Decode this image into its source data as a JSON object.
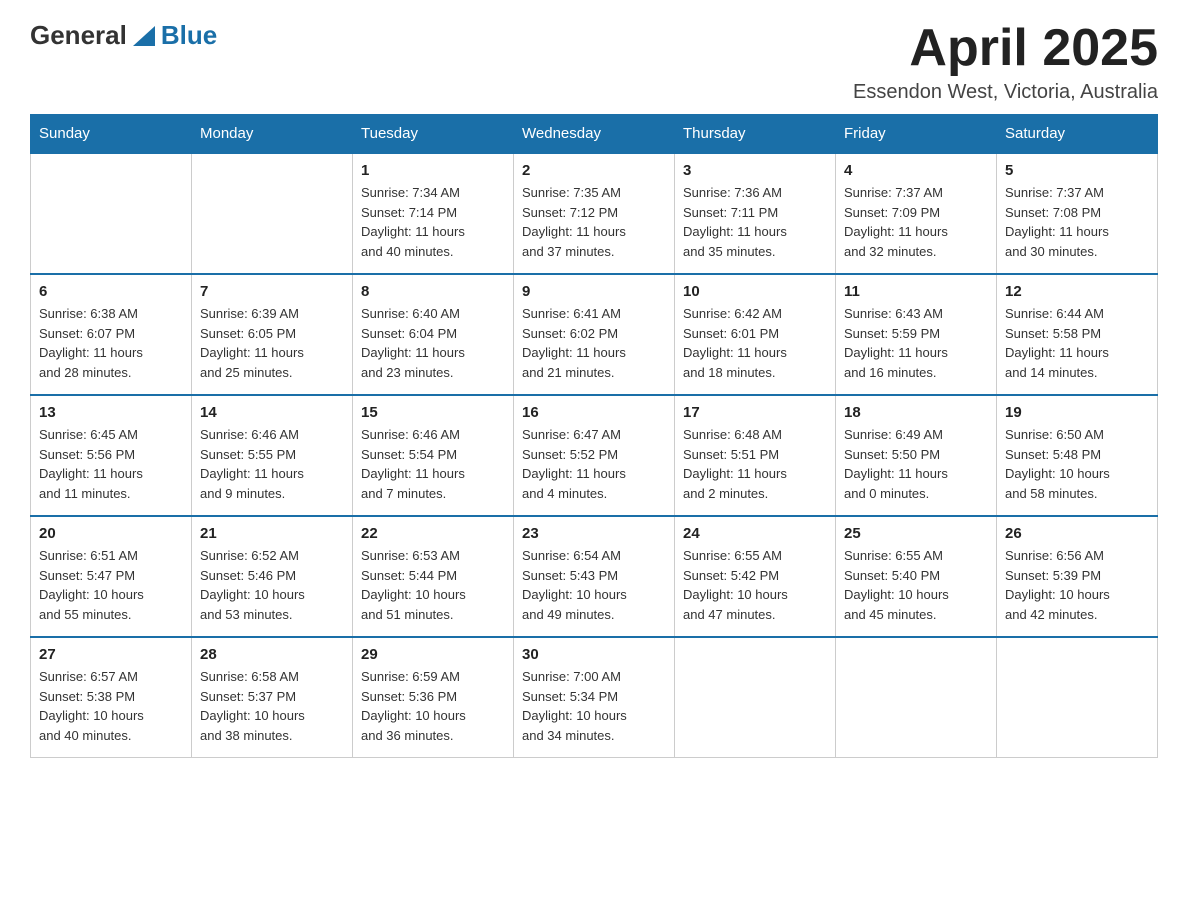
{
  "header": {
    "logo_general": "General",
    "logo_blue": "Blue",
    "month_title": "April 2025",
    "subtitle": "Essendon West, Victoria, Australia"
  },
  "calendar": {
    "days_of_week": [
      "Sunday",
      "Monday",
      "Tuesday",
      "Wednesday",
      "Thursday",
      "Friday",
      "Saturday"
    ],
    "weeks": [
      [
        {
          "day": "",
          "info": ""
        },
        {
          "day": "",
          "info": ""
        },
        {
          "day": "1",
          "info": "Sunrise: 7:34 AM\nSunset: 7:14 PM\nDaylight: 11 hours\nand 40 minutes."
        },
        {
          "day": "2",
          "info": "Sunrise: 7:35 AM\nSunset: 7:12 PM\nDaylight: 11 hours\nand 37 minutes."
        },
        {
          "day": "3",
          "info": "Sunrise: 7:36 AM\nSunset: 7:11 PM\nDaylight: 11 hours\nand 35 minutes."
        },
        {
          "day": "4",
          "info": "Sunrise: 7:37 AM\nSunset: 7:09 PM\nDaylight: 11 hours\nand 32 minutes."
        },
        {
          "day": "5",
          "info": "Sunrise: 7:37 AM\nSunset: 7:08 PM\nDaylight: 11 hours\nand 30 minutes."
        }
      ],
      [
        {
          "day": "6",
          "info": "Sunrise: 6:38 AM\nSunset: 6:07 PM\nDaylight: 11 hours\nand 28 minutes."
        },
        {
          "day": "7",
          "info": "Sunrise: 6:39 AM\nSunset: 6:05 PM\nDaylight: 11 hours\nand 25 minutes."
        },
        {
          "day": "8",
          "info": "Sunrise: 6:40 AM\nSunset: 6:04 PM\nDaylight: 11 hours\nand 23 minutes."
        },
        {
          "day": "9",
          "info": "Sunrise: 6:41 AM\nSunset: 6:02 PM\nDaylight: 11 hours\nand 21 minutes."
        },
        {
          "day": "10",
          "info": "Sunrise: 6:42 AM\nSunset: 6:01 PM\nDaylight: 11 hours\nand 18 minutes."
        },
        {
          "day": "11",
          "info": "Sunrise: 6:43 AM\nSunset: 5:59 PM\nDaylight: 11 hours\nand 16 minutes."
        },
        {
          "day": "12",
          "info": "Sunrise: 6:44 AM\nSunset: 5:58 PM\nDaylight: 11 hours\nand 14 minutes."
        }
      ],
      [
        {
          "day": "13",
          "info": "Sunrise: 6:45 AM\nSunset: 5:56 PM\nDaylight: 11 hours\nand 11 minutes."
        },
        {
          "day": "14",
          "info": "Sunrise: 6:46 AM\nSunset: 5:55 PM\nDaylight: 11 hours\nand 9 minutes."
        },
        {
          "day": "15",
          "info": "Sunrise: 6:46 AM\nSunset: 5:54 PM\nDaylight: 11 hours\nand 7 minutes."
        },
        {
          "day": "16",
          "info": "Sunrise: 6:47 AM\nSunset: 5:52 PM\nDaylight: 11 hours\nand 4 minutes."
        },
        {
          "day": "17",
          "info": "Sunrise: 6:48 AM\nSunset: 5:51 PM\nDaylight: 11 hours\nand 2 minutes."
        },
        {
          "day": "18",
          "info": "Sunrise: 6:49 AM\nSunset: 5:50 PM\nDaylight: 11 hours\nand 0 minutes."
        },
        {
          "day": "19",
          "info": "Sunrise: 6:50 AM\nSunset: 5:48 PM\nDaylight: 10 hours\nand 58 minutes."
        }
      ],
      [
        {
          "day": "20",
          "info": "Sunrise: 6:51 AM\nSunset: 5:47 PM\nDaylight: 10 hours\nand 55 minutes."
        },
        {
          "day": "21",
          "info": "Sunrise: 6:52 AM\nSunset: 5:46 PM\nDaylight: 10 hours\nand 53 minutes."
        },
        {
          "day": "22",
          "info": "Sunrise: 6:53 AM\nSunset: 5:44 PM\nDaylight: 10 hours\nand 51 minutes."
        },
        {
          "day": "23",
          "info": "Sunrise: 6:54 AM\nSunset: 5:43 PM\nDaylight: 10 hours\nand 49 minutes."
        },
        {
          "day": "24",
          "info": "Sunrise: 6:55 AM\nSunset: 5:42 PM\nDaylight: 10 hours\nand 47 minutes."
        },
        {
          "day": "25",
          "info": "Sunrise: 6:55 AM\nSunset: 5:40 PM\nDaylight: 10 hours\nand 45 minutes."
        },
        {
          "day": "26",
          "info": "Sunrise: 6:56 AM\nSunset: 5:39 PM\nDaylight: 10 hours\nand 42 minutes."
        }
      ],
      [
        {
          "day": "27",
          "info": "Sunrise: 6:57 AM\nSunset: 5:38 PM\nDaylight: 10 hours\nand 40 minutes."
        },
        {
          "day": "28",
          "info": "Sunrise: 6:58 AM\nSunset: 5:37 PM\nDaylight: 10 hours\nand 38 minutes."
        },
        {
          "day": "29",
          "info": "Sunrise: 6:59 AM\nSunset: 5:36 PM\nDaylight: 10 hours\nand 36 minutes."
        },
        {
          "day": "30",
          "info": "Sunrise: 7:00 AM\nSunset: 5:34 PM\nDaylight: 10 hours\nand 34 minutes."
        },
        {
          "day": "",
          "info": ""
        },
        {
          "day": "",
          "info": ""
        },
        {
          "day": "",
          "info": ""
        }
      ]
    ]
  }
}
